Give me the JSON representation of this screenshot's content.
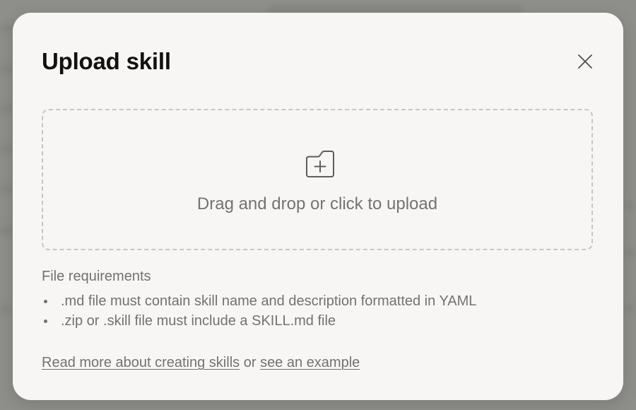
{
  "modal": {
    "title": "Upload skill",
    "close_icon": "close-icon"
  },
  "dropzone": {
    "icon": "folder-plus-icon",
    "text": "Drag and drop or click to upload"
  },
  "requirements": {
    "title": "File requirements",
    "items": [
      ".md file must contain skill name and description formatted in YAML",
      ".zip or .skill file must include a SKILL.md file"
    ]
  },
  "footer": {
    "link_1": "Read more about creating skills",
    "separator": "or",
    "link_2": "see an example"
  },
  "colors": {
    "modal_background": "#f7f6f4",
    "backdrop": "#8e8e8b",
    "title_text": "#111111",
    "secondary_text": "#73726e",
    "dropzone_border": "#c8c6c1"
  }
}
